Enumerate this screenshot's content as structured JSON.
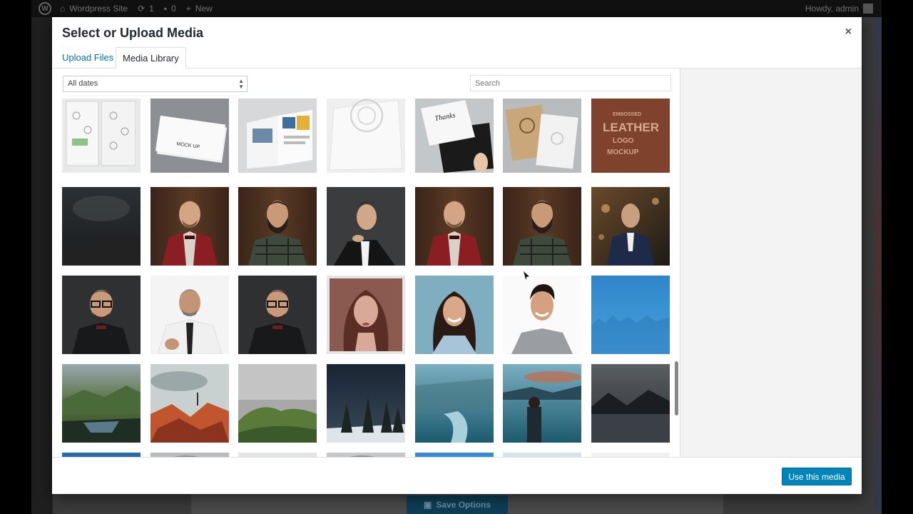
{
  "adminbar": {
    "site_name": "Wordpress Site",
    "updates_count": "1",
    "comments_count": "0",
    "new_label": "New",
    "howdy": "Howdy, admin"
  },
  "background": {
    "save_options_label": "Save Options"
  },
  "modal": {
    "title": "Select or Upload Media",
    "close_icon": "×",
    "tabs": [
      {
        "label": "Upload Files",
        "active": false
      },
      {
        "label": "Media Library",
        "active": true
      }
    ],
    "filter": {
      "date_selected": "All dates"
    },
    "search": {
      "placeholder": "Search"
    },
    "footer": {
      "use_media_label": "Use this media"
    }
  },
  "media_grid": {
    "rows": [
      [
        "stationery mockup",
        "business card mock up",
        "magazine mockup",
        "embossed logo mockup",
        "thank you card mockup",
        "kraft cards mockup",
        "embossed leather logo mockup"
      ],
      [
        "dark room",
        "man in red blazer",
        "bearded man plaid shirt",
        "man in tuxedo profile",
        "man in red blazer",
        "bearded man plaid shirt",
        "man in blue suit"
      ],
      [
        "man with glasses",
        "gray-haired man",
        "man with glasses",
        "woman portrait",
        "smiling woman",
        "smiling man",
        "blue forest"
      ],
      [
        "mountain valley",
        "red rocks",
        "green hills",
        "snowy forest night",
        "river valley",
        "man by lake",
        "mountain lake"
      ],
      [
        "blue mountain",
        "misty peak",
        "pale texture",
        "cloudy peak",
        "snowy mountains",
        "mountain range",
        "gray blank"
      ]
    ]
  },
  "colors": {
    "accent": "#0085ba",
    "link": "#0073aa",
    "adminbar": "#111111"
  }
}
